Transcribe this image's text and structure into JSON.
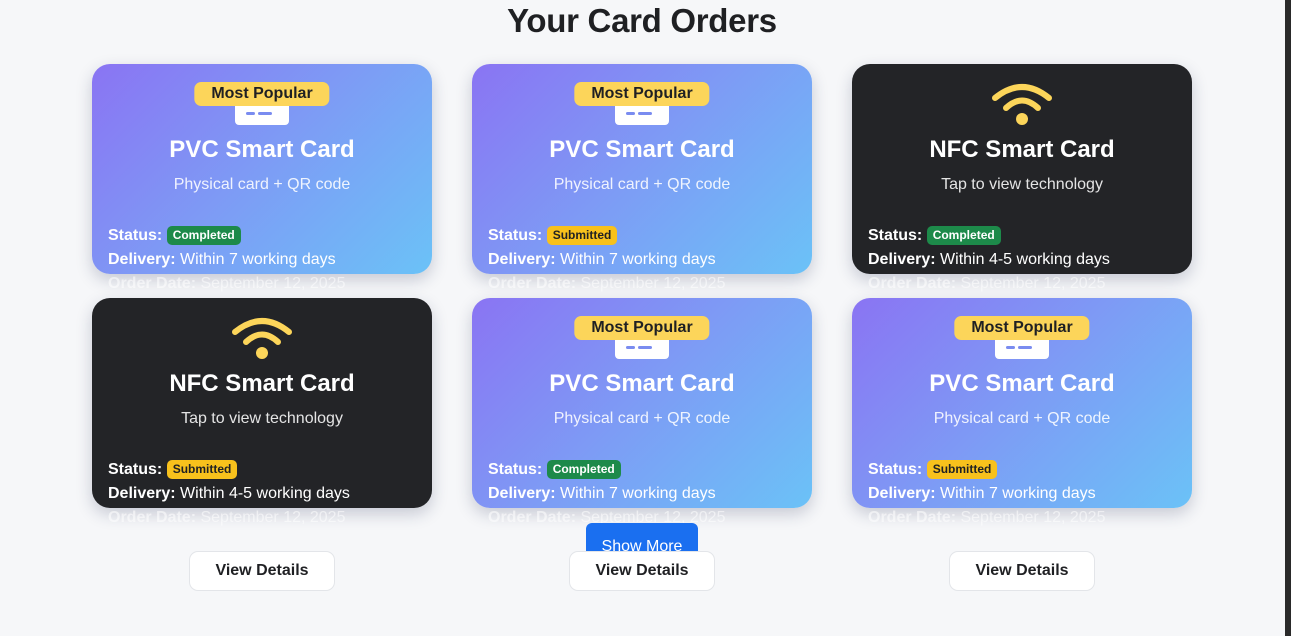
{
  "page": {
    "title": "Your Card Orders"
  },
  "labels": {
    "status": "Status:",
    "delivery": "Delivery:",
    "order_date": "Order Date:"
  },
  "colors": {
    "pvc_gradient_start": "#8a74f3",
    "pvc_gradient_end": "#6bc2f7",
    "nfc_bg": "#232427",
    "badge": "#fcd55a",
    "completed": "#1d8a4a",
    "submitted": "#f8c11c",
    "primary_button": "#1a6ff0"
  },
  "cards": [
    {
      "type": "pvc",
      "icon": "card-icon",
      "badge": "Most Popular",
      "title": "PVC Smart Card",
      "subtitle": "Physical card + QR code",
      "status": "Completed",
      "delivery": "Within 7 working days",
      "order_date": "September 12, 2025"
    },
    {
      "type": "pvc",
      "icon": "card-icon",
      "badge": "Most Popular",
      "title": "PVC Smart Card",
      "subtitle": "Physical card + QR code",
      "status": "Submitted",
      "delivery": "Within 7 working days",
      "order_date": "September 12, 2025"
    },
    {
      "type": "nfc",
      "icon": "wifi-icon",
      "title": "NFC Smart Card",
      "subtitle": "Tap to view technology",
      "status": "Completed",
      "delivery": "Within 4-5 working days",
      "order_date": "September 12, 2025"
    },
    {
      "type": "nfc",
      "icon": "wifi-icon",
      "title": "NFC Smart Card",
      "subtitle": "Tap to view technology",
      "status": "Submitted",
      "delivery": "Within 4-5 working days",
      "order_date": "September 12, 2025"
    },
    {
      "type": "pvc",
      "icon": "card-icon",
      "badge": "Most Popular",
      "title": "PVC Smart Card",
      "subtitle": "Physical card + QR code",
      "status": "Completed",
      "delivery": "Within 7 working days",
      "order_date": "September 12, 2025"
    },
    {
      "type": "pvc",
      "icon": "card-icon",
      "badge": "Most Popular",
      "title": "PVC Smart Card",
      "subtitle": "Physical card + QR code",
      "status": "Submitted",
      "delivery": "Within 7 working days",
      "order_date": "September 12, 2025"
    }
  ],
  "actions": {
    "show_more": "Show More",
    "view_details": "View Details"
  }
}
